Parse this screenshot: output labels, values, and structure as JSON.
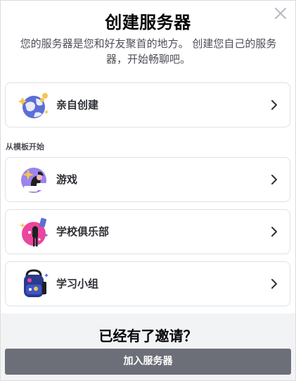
{
  "dialog": {
    "title": "创建服务器",
    "subtitle": "您的服务器是您和好友聚首的地方。 创建您自己的服务器，开始畅聊吧。"
  },
  "create_own": {
    "label": "亲自创建",
    "icon": "globe-with-sparkles-icon"
  },
  "templates": {
    "section_label": "从模板开始",
    "items": [
      {
        "label": "游戏",
        "icon": "gaming-character-icon"
      },
      {
        "label": "学校俱乐部",
        "icon": "school-club-icon"
      },
      {
        "label": "学习小组",
        "icon": "study-backpack-icon"
      }
    ]
  },
  "footer": {
    "title": "已经有了邀请？",
    "join_button_label": "加入服务器"
  },
  "colors": {
    "join_button": "#6d6f78",
    "footer_background": "#f2f3f5",
    "card_border": "#dfe1e4"
  }
}
